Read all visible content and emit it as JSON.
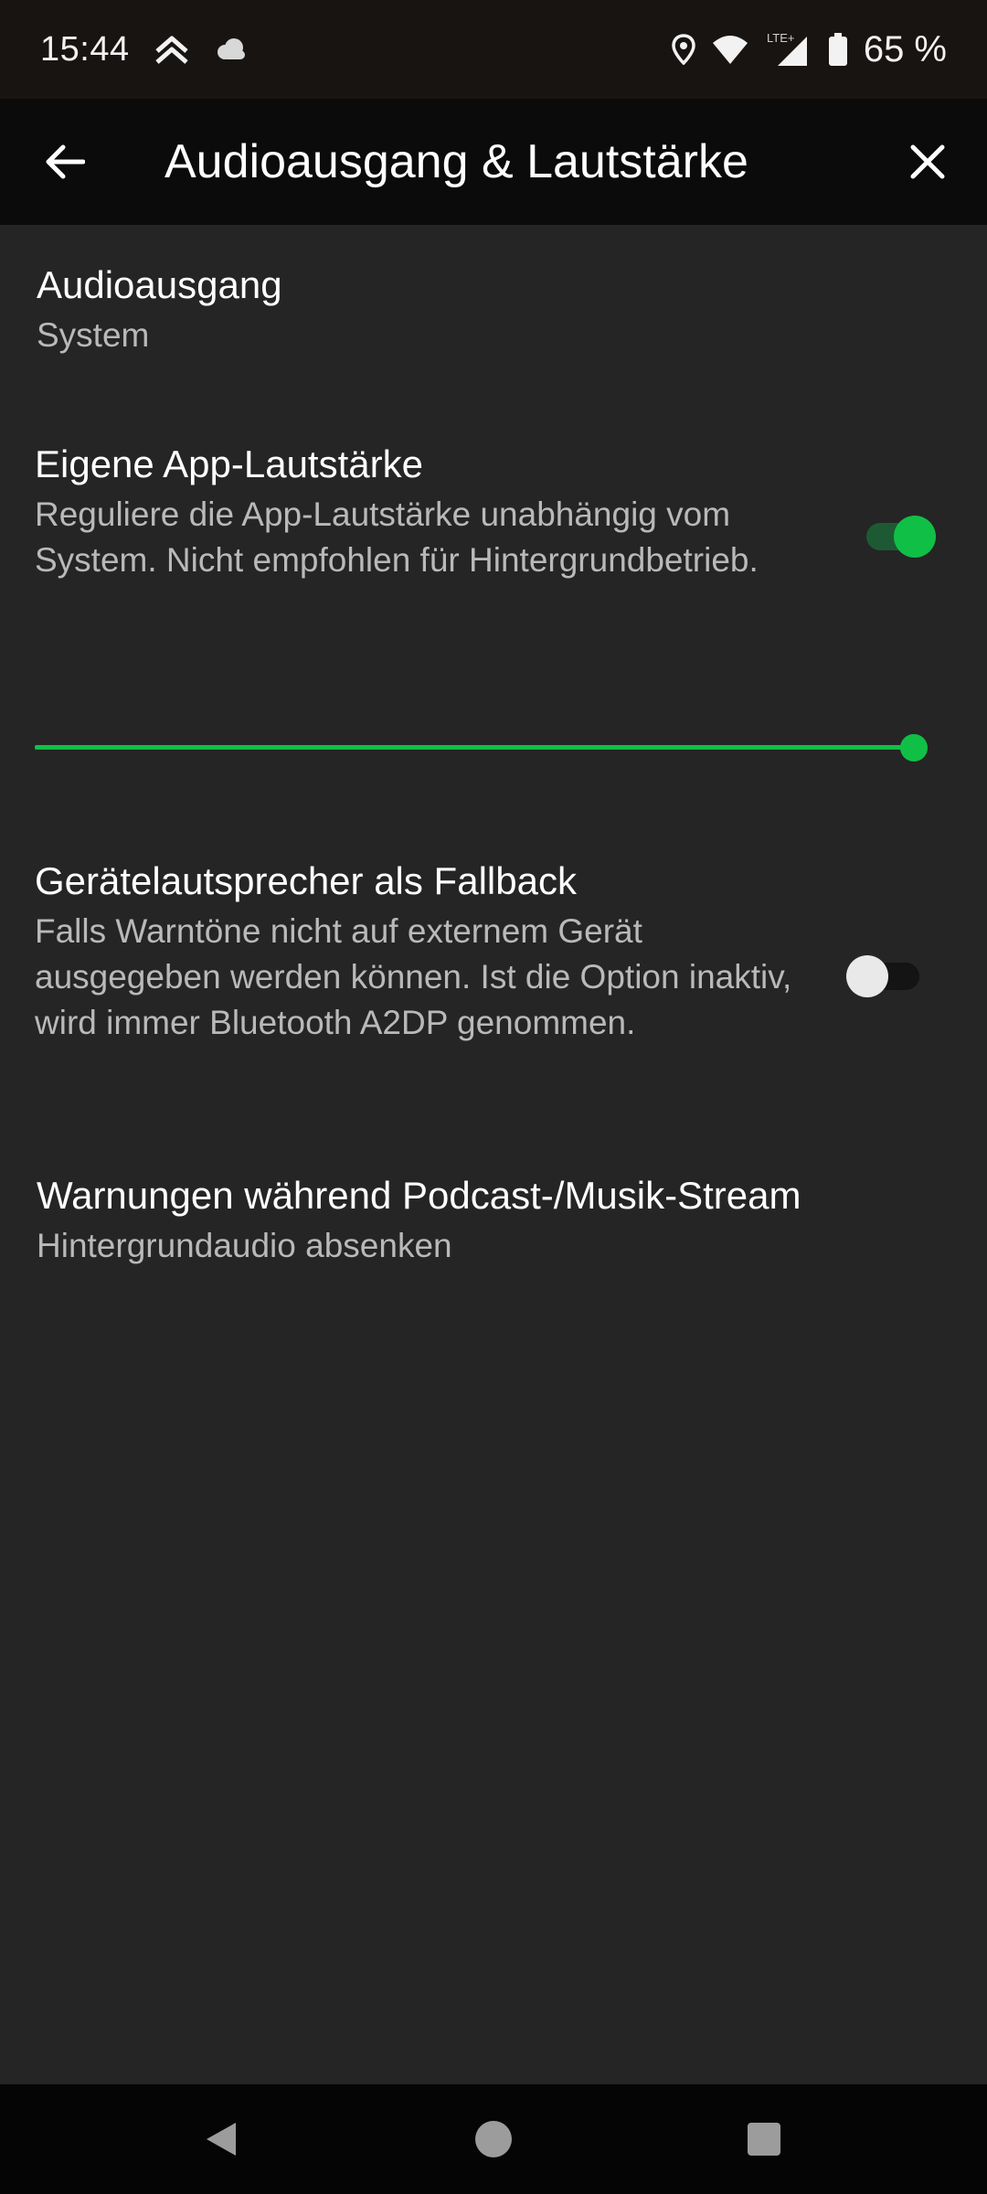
{
  "status_bar": {
    "time": "15:44",
    "battery_text": "65 %",
    "network_label": "LTE+",
    "icons": [
      "navigation-app-icon",
      "cloud-icon",
      "location-icon",
      "wifi-icon",
      "signal-icon",
      "battery-icon"
    ]
  },
  "app_bar": {
    "title": "Audioausgang & Lautstärke",
    "back_icon": "arrow-left-icon",
    "close_icon": "close-icon"
  },
  "settings": {
    "audio_output": {
      "title": "Audioausgang",
      "value": "System"
    },
    "app_volume": {
      "title": "Eigene App-Lautstärke",
      "description": "Reguliere die App-Lautstärke unabhängig vom System. Nicht empfohlen für Hintergrundbetrieb.",
      "enabled": true,
      "level": 1.0
    },
    "fallback": {
      "title": "Gerätelautsprecher als Fallback",
      "description": "Falls Warntöne nicht auf externem Gerät ausgegeben werden können. Ist die Option inaktiv, wird immer Bluetooth A2DP genommen.",
      "enabled": false
    },
    "warnings": {
      "title": "Warnungen während Podcast-/Musik-Stream",
      "value": "Hintergrundaudio absenken"
    }
  },
  "colors": {
    "accent": "#10c046",
    "background": "#252525",
    "app_bar": "#0b0b0b"
  },
  "nav_bar": {
    "buttons": [
      "back-triangle-icon",
      "home-circle-icon",
      "recents-square-icon"
    ]
  }
}
